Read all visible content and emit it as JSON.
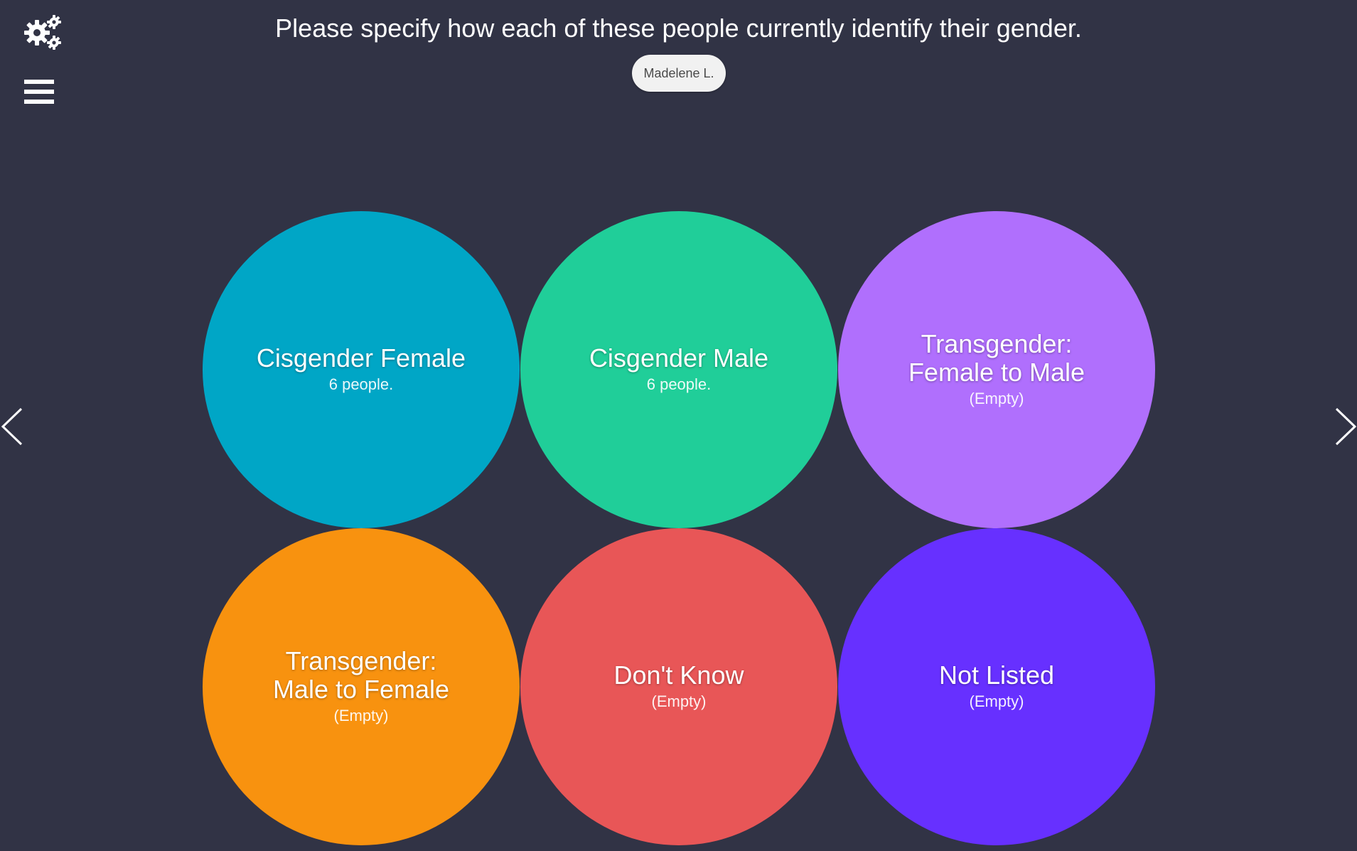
{
  "prompt": "Please specify how each of these people currently identify their gender.",
  "person": {
    "name": "Madelene L."
  },
  "icons": {
    "settings": "gears-icon",
    "menu": "hamburger-menu-icon",
    "prev": "chevron-left-icon",
    "next": "chevron-right-icon"
  },
  "categories": [
    {
      "label": "Cisgender Female",
      "count": "6 people.",
      "color": "#00A6C6"
    },
    {
      "label": "Cisgender Male",
      "count": "6 people.",
      "color": "#20CE99"
    },
    {
      "label": "Transgender: Female to Male",
      "count": "(Empty)",
      "color": "#B06FFD"
    },
    {
      "label": "Transgender: Male to Female",
      "count": "(Empty)",
      "color": "#F8920F"
    },
    {
      "label": "Don't Know",
      "count": "(Empty)",
      "color": "#E85657"
    },
    {
      "label": "Not Listed",
      "count": "(Empty)",
      "color": "#6730FF"
    }
  ]
}
